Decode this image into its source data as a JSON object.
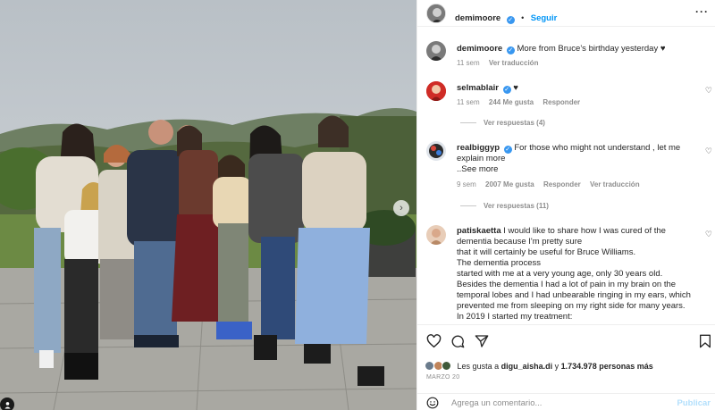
{
  "header": {
    "username": "demimoore",
    "follow_label": "Seguir",
    "more_icon": "more-horizontal-icon"
  },
  "caption": {
    "username": "demimoore",
    "text": "More from Bruce’s birthday yesterday ♥",
    "time": "11 sem",
    "translate_label": "Ver traducción"
  },
  "comments": [
    {
      "username": "selmablair",
      "text": "♥",
      "time": "11 sem",
      "likes": "244 Me gusta",
      "reply_label": "Responder",
      "view_replies": "Ver respuestas (4)"
    },
    {
      "username": "realbiggyp",
      "text": "For those who might not understand , let me explain more",
      "see_more": "..See more",
      "time": "9 sem",
      "likes": "2007 Me gusta",
      "reply_label": "Responder",
      "translate_label": "Ver traducción",
      "view_replies": "Ver respuestas (11)"
    },
    {
      "username": "patiskaetta",
      "lines": [
        "I would like to share how I was cured of the dementia because I'm pretty sure",
        "that it will certainly be useful for Bruce Williams.",
        "The dementia process",
        "started with me at a very young age, only 30 years old.",
        "Besides the dementia I had a lot of pain in my brain on the temporal lobes and I had unbearable ringing in my ears, which prevented me from sleeping on my right side for many years.",
        "In 2019 I started my treatment:"
      ]
    }
  ],
  "likes_summary": {
    "prefix": "Les gusta a",
    "user": "digu_aisha.di",
    "connector": "y",
    "count": "1.734.978 personas más"
  },
  "date": "MARZO 20",
  "add_comment": {
    "placeholder": "Agrega un comentario...",
    "publish_label": "Publicar"
  },
  "colors": {
    "accent": "#0095f6",
    "verified": "#3897f0",
    "muted": "#8e8e8e"
  }
}
